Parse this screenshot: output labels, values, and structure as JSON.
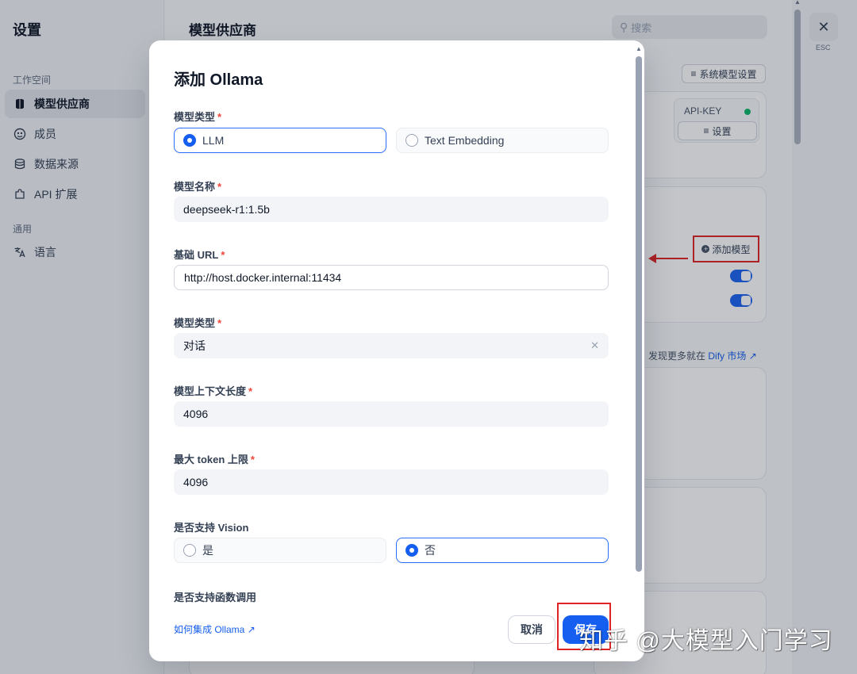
{
  "sidebar": {
    "title": "设置",
    "workspace_section": "工作空间",
    "general_section": "通用",
    "items": [
      {
        "label": "模型供应商",
        "icon": "brain-icon"
      },
      {
        "label": "成员",
        "icon": "members-icon"
      },
      {
        "label": "数据来源",
        "icon": "database-icon"
      },
      {
        "label": "API 扩展",
        "icon": "puzzle-icon"
      },
      {
        "label": "语言",
        "icon": "translate-icon"
      }
    ]
  },
  "main": {
    "title": "模型供应商",
    "search_placeholder": "搜索",
    "system_model_settings": "系统模型设置",
    "api_key_label": "API-KEY",
    "api_key_settings": "设置",
    "add_model": "添加模型",
    "discover_prefix": "发现更多就在",
    "discover_link": "Dify 市场 ↗",
    "esc_label": "ESC"
  },
  "modal": {
    "title": "添加 Ollama",
    "model_type_label": "模型类型",
    "model_type_options": [
      "LLM",
      "Text Embedding"
    ],
    "model_type_selected": "LLM",
    "model_name_label": "模型名称",
    "model_name_value": "deepseek-r1:1.5b",
    "base_url_label": "基础 URL",
    "base_url_value": "http://host.docker.internal:11434",
    "completion_type_label": "模型类型",
    "completion_type_value": "对话",
    "context_length_label": "模型上下文长度",
    "context_length_value": "4096",
    "max_token_label": "最大 token 上限",
    "max_token_value": "4096",
    "vision_label": "是否支持 Vision",
    "vision_options": [
      "是",
      "否"
    ],
    "vision_selected": "否",
    "function_call_label": "是否支持函数调用",
    "help_link": "如何集成 Ollama",
    "cancel": "取消",
    "save": "保存"
  },
  "watermark": "知乎 @大模型入门学习",
  "colors": {
    "accent": "#155eef",
    "highlight": "#e02424",
    "status_ok": "#12b76a"
  }
}
